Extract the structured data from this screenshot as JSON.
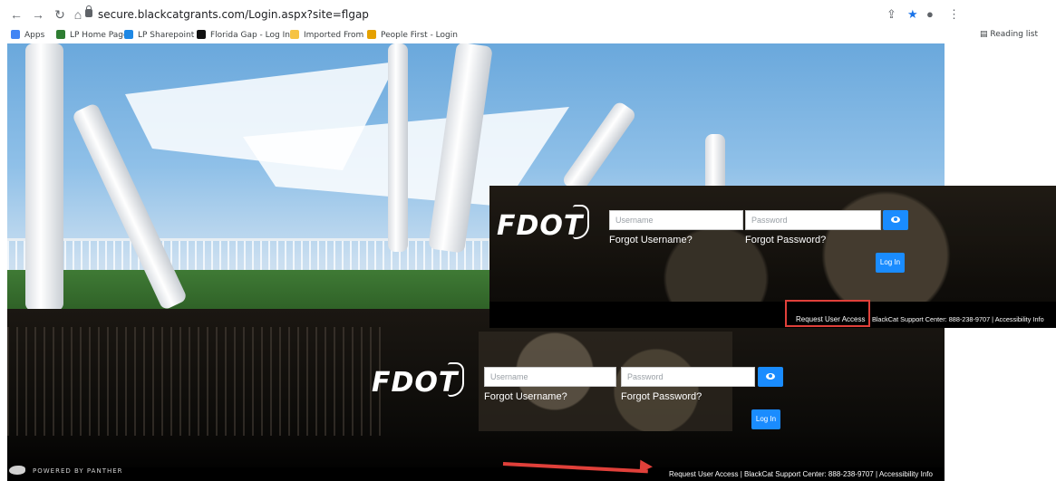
{
  "browser": {
    "url": "secure.blackcatgrants.com/Login.aspx?site=flgap",
    "bookmarks": [
      {
        "label": "Apps",
        "color": "#4285f4"
      },
      {
        "label": "LP Home Page",
        "color": "#2e7d32"
      },
      {
        "label": "LP Sharepoint",
        "color": "#1e88e5"
      },
      {
        "label": "Florida Gap - Log In",
        "color": "#111111"
      },
      {
        "label": "Imported From IE",
        "color": "#f6c344"
      },
      {
        "label": "People First - Login",
        "color": "#e5a100"
      }
    ],
    "reading_list": "Reading list"
  },
  "login_overlay": {
    "logo": "FDOT",
    "username_placeholder": "Username",
    "password_placeholder": "Password",
    "forgot_username": "Forgot Username?",
    "forgot_password": "Forgot Password?",
    "login_button": "Log In",
    "footer_request": "Request User Access",
    "footer_rest": "BlackCat Support Center: 888-238-9707 | Accessibility Info"
  },
  "login_bottom": {
    "logo": "FDOT",
    "username_placeholder": "Username",
    "password_placeholder": "Password",
    "forgot_username": "Forgot Username?",
    "forgot_password": "Forgot Password?",
    "login_button": "Log In",
    "footer": "Request User Access | BlackCat Support Center: 888-238-9707 | Accessibility Info"
  },
  "powered_by": "POWERED BY PANTHER",
  "colors": {
    "accent": "#1a8cff",
    "annotation": "#e0403a"
  }
}
